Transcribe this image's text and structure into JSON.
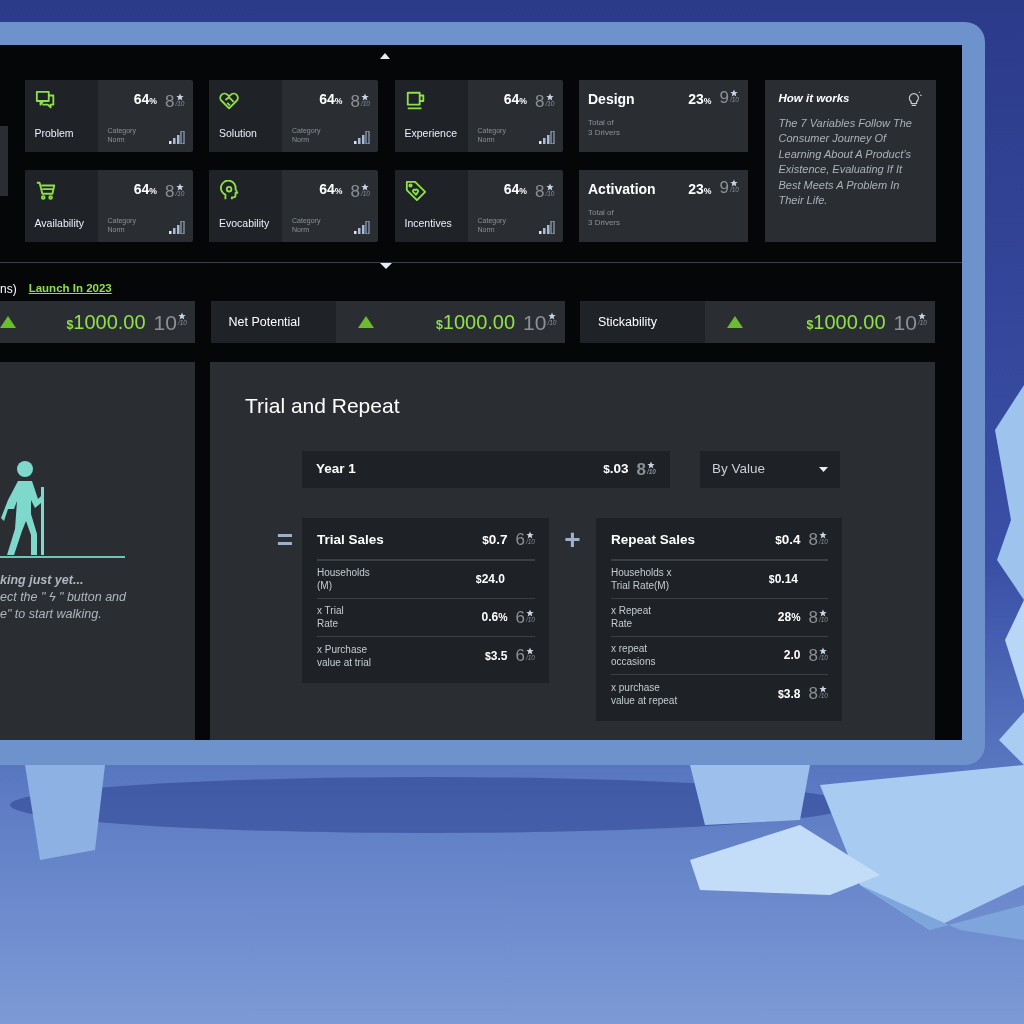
{
  "screen": {
    "drivers": [
      {
        "label": "Problem",
        "amount": "64",
        "unit": "%",
        "score": "8",
        "score_max": "/10",
        "norm_label": "Category\nNorm"
      },
      {
        "label": "Solution",
        "amount": "64",
        "unit": "%",
        "score": "8",
        "score_max": "/10",
        "norm_label": "Category\nNorm"
      },
      {
        "label": "Experience",
        "amount": "64",
        "unit": "%",
        "score": "8",
        "score_max": "/10",
        "norm_label": "Category\nNorm"
      },
      {
        "label": "Availability",
        "amount": "64",
        "unit": "%",
        "score": "8",
        "score_max": "/10",
        "norm_label": "Category\nNorm"
      },
      {
        "label": "Evocability",
        "amount": "64",
        "unit": "%",
        "score": "8",
        "score_max": "/10",
        "norm_label": "Category\nNorm"
      },
      {
        "label": "Incentives",
        "amount": "64",
        "unit": "%",
        "score": "8",
        "score_max": "/10",
        "norm_label": "Category\nNorm"
      }
    ],
    "groups": [
      {
        "title": "Design",
        "amount": "23",
        "unit": "%",
        "score": "9",
        "score_max": "/10",
        "note": "Total of\n3 Drivers"
      },
      {
        "title": "Activation",
        "amount": "23",
        "unit": "%",
        "score": "9",
        "score_max": "/10",
        "note": "Total of\n3 Drivers"
      }
    ],
    "how_it_works": {
      "title": "How it works",
      "text": "The 7 Variables Follow The Consumer Journey Of Learning About A Product’s Existence, Evaluating If It Best Meets A Problem In Their Life."
    },
    "section_label": "ns)",
    "launch_link": "Launch In 2023",
    "metrics": [
      {
        "rising": true,
        "prefix": "$",
        "amount": "1000.00",
        "score": "10",
        "score_max": "/10"
      },
      {
        "label": "Net Potential",
        "rising": true,
        "prefix": "$",
        "amount": "1000.00",
        "score": "10",
        "score_max": "/10"
      },
      {
        "label": "Stickability",
        "rising": true,
        "prefix": "$",
        "amount": "1000.00",
        "score": "10",
        "score_max": "/10"
      }
    ],
    "empty_state": {
      "title": "king just yet...",
      "lines": [
        "ect the \" ϟ \" button and",
        "e\" to start walking."
      ]
    },
    "trial_repeat": {
      "title": "Trial and Repeat",
      "period": {
        "label": "Year 1",
        "prefix": "$",
        "amount": ".03",
        "score": "8",
        "score_max": "/10"
      },
      "dropdown": {
        "value": "By Value"
      },
      "equals": "=",
      "plus": "+",
      "cards": [
        {
          "title": "Trial Sales",
          "prefix": "$",
          "amount": "0.7",
          "score": "6",
          "score_max": "/10",
          "rows": [
            {
              "label": "Households\n(M)",
              "prefix": "$",
              "amount": "24.0"
            },
            {
              "label": "x Trial\nRate",
              "amount": "0.6",
              "suffix": "%",
              "score": "6",
              "score_max": "/10"
            },
            {
              "label": "x Purchase\nvalue at trial",
              "prefix": "$",
              "amount": "3.5",
              "score": "6",
              "score_max": "/10"
            }
          ]
        },
        {
          "title": "Repeat Sales",
          "prefix": "$",
          "amount": "0.4",
          "score": "8",
          "score_max": "/10",
          "rows": [
            {
              "label": "Households x\nTrial Rate(M)",
              "prefix": "$",
              "amount": "0.14"
            },
            {
              "label": "x Repeat\nRate",
              "amount": "28",
              "suffix": "%",
              "score": "8",
              "score_max": "/10"
            },
            {
              "label": "x repeat\noccasions",
              "amount": "2.0",
              "score": "8",
              "score_max": "/10"
            },
            {
              "label": "x purchase\nvalue at repeat",
              "prefix": "$",
              "amount": "3.8",
              "score": "8",
              "score_max": "/10"
            }
          ]
        }
      ]
    }
  }
}
